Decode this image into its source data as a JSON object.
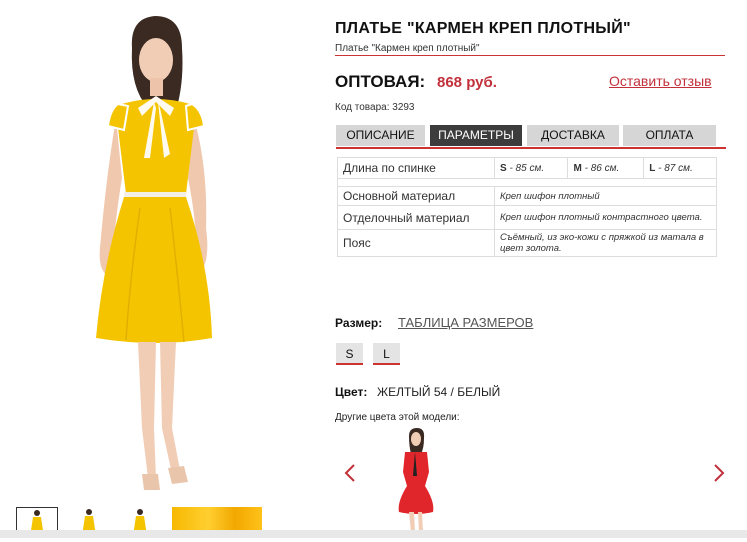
{
  "product": {
    "title": "ПЛАТЬЕ \"КАРМЕН КРЕП ПЛОТНЫЙ\"",
    "subtitle": "Платье \"Кармен креп плотный\"",
    "price_label": "ОПТОВАЯ:",
    "price_value": "868 руб.",
    "review_link": "Оставить отзыв",
    "sku": "Код товара: 3293"
  },
  "tabs": [
    {
      "label": "ОПИСАНИЕ"
    },
    {
      "label": "ПАРАМЕТРЫ"
    },
    {
      "label": "ДОСТАВКА"
    },
    {
      "label": "ОПЛАТА"
    }
  ],
  "params": {
    "length": {
      "label": "Длина по спинке",
      "sizes": [
        {
          "size": "S",
          "value": " - 85 см."
        },
        {
          "size": "M",
          "value": " - 86 см."
        },
        {
          "size": "L",
          "value": " - 87 см."
        }
      ]
    },
    "rows": [
      {
        "label": "Основной материал",
        "value": "Креп шифон плотный"
      },
      {
        "label": "Отделочный материал",
        "value": "Креп шифон плотный контрастного цвета."
      },
      {
        "label": "Пояс",
        "value": "Съёмный, из эко-кожи с пряжкой из матала в цвет золота."
      }
    ]
  },
  "size": {
    "label": "Размер:",
    "table_link": "ТАБЛИЦА РАЗМЕРОВ",
    "options": [
      "S",
      "L"
    ]
  },
  "color": {
    "label": "Цвет:",
    "value": "ЖЕЛТЫЙ 54 / БЕЛЫЙ",
    "other_label": "Другие цвета этой модели:"
  },
  "colors": {
    "accent": "#c2313b",
    "dress_yellow": "#f5c400",
    "tab_active": "#3c3c3c"
  },
  "icons": {
    "prev": "chevron-left-icon",
    "next": "chevron-right-icon"
  }
}
